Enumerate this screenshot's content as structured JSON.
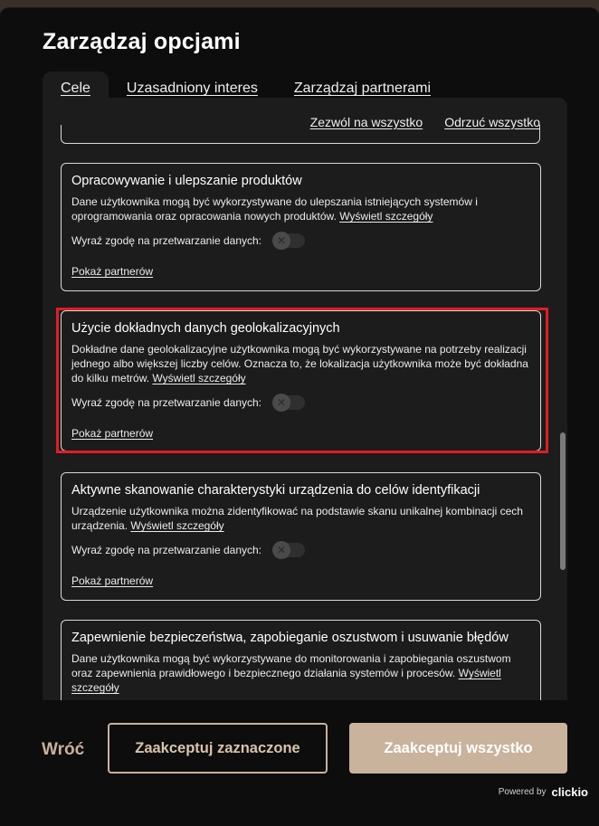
{
  "modal": {
    "title": "Zarządzaj opcjami",
    "tabs": [
      {
        "label": "Cele",
        "active": true
      },
      {
        "label": "Uzasadniony interes",
        "active": false
      },
      {
        "label": "Zarządzaj partnerami",
        "active": false
      }
    ],
    "bulk": {
      "allow_all": "Zezwól na wszystko",
      "reject_all": "Odrzuć wszystko"
    },
    "cards": [
      {
        "title": "Opracowywanie i ulepszanie produktów",
        "description": "Dane użytkownika mogą być wykorzystywane do ulepszania istniejących systemów i oprogramowania oraz opracowania nowych produktów.",
        "details_link": "Wyświetl szczegóły",
        "consent_label": "Wyraź zgodę na przetwarzanie danych:",
        "consent_on": false,
        "partners_link": "Pokaż partnerów"
      },
      {
        "title": "Użycie dokładnych danych geolokalizacyjnych",
        "description": "Dokładne dane geolokalizacyjne użytkownika mogą być wykorzystywane na potrzeby realizacji jednego albo większej liczby celów. Oznacza to, że lokalizacja użytkownika może być dokładna do kilku metrów.",
        "details_link": "Wyświetl szczegóły",
        "consent_label": "Wyraź zgodę na przetwarzanie danych:",
        "consent_on": false,
        "partners_link": "Pokaż partnerów"
      },
      {
        "title": "Aktywne skanowanie charakterystyki urządzenia do celów identyfikacji",
        "description": "Urządzenie użytkownika można zidentyfikować na podstawie skanu unikalnej kombinacji cech urządzenia.",
        "details_link": "Wyświetl szczegóły",
        "consent_label": "Wyraź zgodę na przetwarzanie danych:",
        "consent_on": false,
        "partners_link": "Pokaż partnerów"
      },
      {
        "title": "Zapewnienie bezpieczeństwa, zapobieganie oszustwom i usuwanie błędów",
        "description": "Dane użytkownika mogą być wykorzystywane do monitorowania i zapobiegania oszustwom oraz zapewnienia prawidłowego i bezpiecznego działania systemów i procesów.",
        "details_link": "Wyświetl szczegóły"
      }
    ],
    "footer": {
      "back": "Wróć",
      "accept_selected": "Zaakceptuj zaznaczone",
      "accept_all": "Zaakceptuj wszystko",
      "powered_by": "Powered by",
      "brand": "clickio"
    },
    "colors": {
      "accent": "#c9b39c",
      "highlight": "#e11d24",
      "background": "#0d0d0d",
      "panel": "#1c1c1c"
    }
  }
}
